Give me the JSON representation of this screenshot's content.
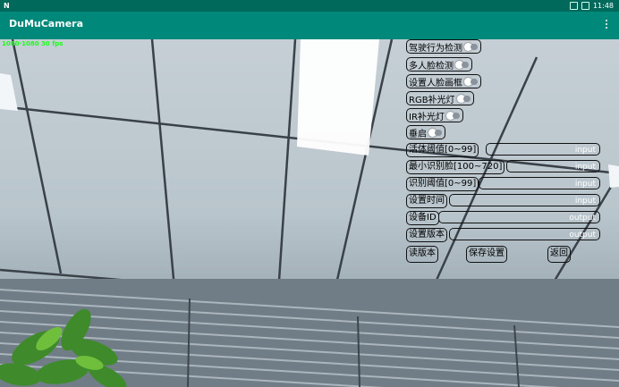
{
  "status_bar": {
    "left_glyph": "N",
    "time": "11:48"
  },
  "app_bar": {
    "title": "DuMuCamera"
  },
  "camera": {
    "overlay_text": "1080·1080 30 fps"
  },
  "panel": {
    "switches": [
      {
        "label": "驾驶行为检测",
        "on": false
      },
      {
        "label": "多人脸检测",
        "on": false
      },
      {
        "label": "设置人脸画框",
        "on": false
      },
      {
        "label": "RGB补光灯",
        "on": false
      },
      {
        "label": "IR补光灯",
        "on": false
      },
      {
        "label": "垂启",
        "on": false
      }
    ],
    "fields": [
      {
        "label": "活体阈值[0~99]",
        "placeholder": "input"
      },
      {
        "label": "最小识别脸[100~720]",
        "placeholder": "input"
      },
      {
        "label": "识别阈值[0~99]",
        "placeholder": "input"
      },
      {
        "label": "设置时间",
        "placeholder": "input"
      },
      {
        "label": "设备ID",
        "placeholder": "output"
      },
      {
        "label": "设置版本",
        "placeholder": "output"
      }
    ],
    "buttons": {
      "read_version": "读版本",
      "save": "保存设置",
      "back": "返回"
    }
  }
}
